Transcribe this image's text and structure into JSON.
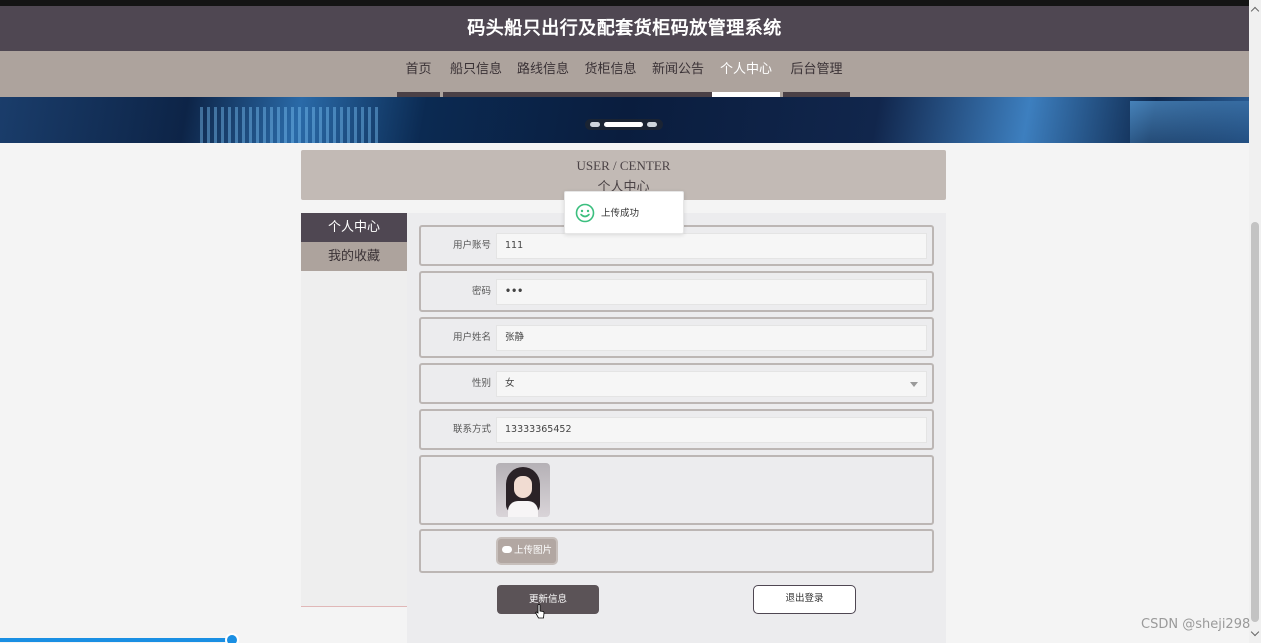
{
  "site": {
    "title": "码头船只出行及配套货柜码放管理系统"
  },
  "nav": {
    "items": [
      {
        "label": "首页"
      },
      {
        "label": "船只信息"
      },
      {
        "label": "路线信息"
      },
      {
        "label": "货柜信息"
      },
      {
        "label": "新闻公告"
      },
      {
        "label": "个人中心"
      },
      {
        "label": "后台管理"
      }
    ],
    "active": "个人中心"
  },
  "page_header": {
    "en": "USER / CENTER",
    "cn": "个人中心"
  },
  "sidebar": {
    "items": [
      {
        "label": "个人中心"
      },
      {
        "label": "我的收藏"
      }
    ]
  },
  "form": {
    "account_label": "用户账号",
    "account_value": "111",
    "password_label": "密码",
    "password_value": "•••",
    "name_label": "用户姓名",
    "name_value": "张静",
    "gender_label": "性别",
    "gender_value": "女",
    "contact_label": "联系方式",
    "contact_value": "13333365452",
    "upload_label": "上传图片",
    "update_button": "更新信息",
    "logout_button": "退出登录"
  },
  "toast": {
    "message": "上传成功"
  },
  "watermark": "CSDN @sheji298",
  "colors": {
    "header": "#4f4752",
    "nav": "#ada39d",
    "accent": "#5b5357",
    "success": "#3cbf7f"
  },
  "icons": [
    "smile-icon",
    "cloud-upload-icon",
    "pointer-cursor-icon"
  ]
}
